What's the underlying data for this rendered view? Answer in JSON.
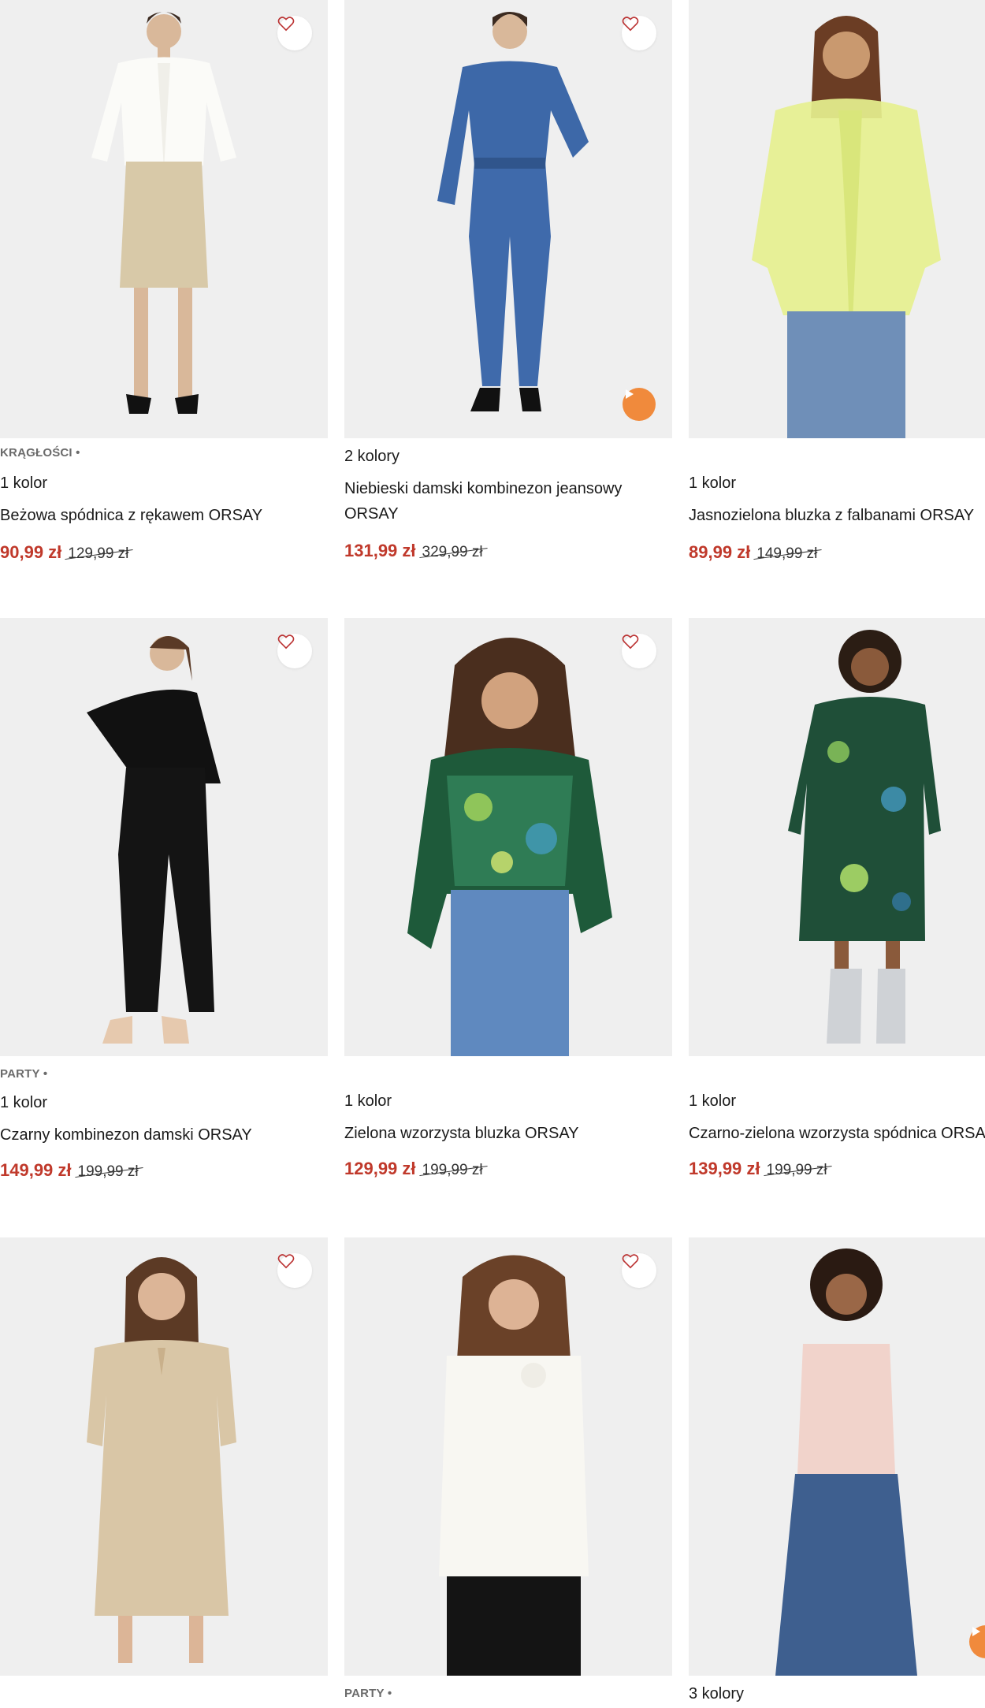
{
  "colors": {
    "accent_price": "#c0392b",
    "play_button": "#f08a3c",
    "photo_bg": "#efefef"
  },
  "products": [
    {
      "tag": "KRĄGŁOŚCI •",
      "colors_label": "1 kolor",
      "title": "Beżowa spódnica z rękawem ORSAY",
      "price": "90,99 zł",
      "old_price": "129,99 zł"
    },
    {
      "tag": "",
      "colors_label": "2 kolory",
      "title": "Niebieski damski kombinezon jeansowy ORSAY",
      "price": "131,99 zł",
      "old_price": "329,99 zł"
    },
    {
      "tag": "",
      "colors_label": "1 kolor",
      "title": "Jasnozielona bluzka z falbanami ORSAY",
      "price": "89,99 zł",
      "old_price": "149,99 zł"
    },
    {
      "tag": "PARTY •",
      "colors_label": "1 kolor",
      "title": "Czarny kombinezon damski ORSAY",
      "price": "149,99 zł",
      "old_price": "199,99 zł"
    },
    {
      "tag": "",
      "colors_label": "1 kolor",
      "title": "Zielona wzorzysta bluzka ORSAY",
      "price": "129,99 zł",
      "old_price": "199,99 zł"
    },
    {
      "tag": "",
      "colors_label": "1 kolor",
      "title": "Czarno-zielona wzorzysta spódnica ORSAY",
      "price": "139,99 zł",
      "old_price": "199,99 zł"
    },
    {
      "tag": "",
      "colors_label": "",
      "title": "",
      "price": "",
      "old_price": ""
    },
    {
      "tag": "PARTY •",
      "colors_label": "",
      "title": "",
      "price": "",
      "old_price": ""
    },
    {
      "tag": "",
      "colors_label": "3 kolory",
      "title": "",
      "price": "",
      "old_price": ""
    }
  ]
}
